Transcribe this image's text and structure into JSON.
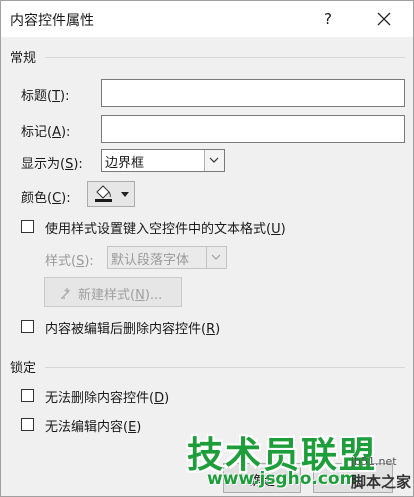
{
  "dialog": {
    "title": "内容控件属性",
    "help_label": "?"
  },
  "general": {
    "section_label": "常规",
    "title_field": {
      "label": "标题(",
      "key": "T",
      "close": "):",
      "value": ""
    },
    "tag_field": {
      "label": "标记(",
      "key": "A",
      "close": "):",
      "value": ""
    },
    "show_as": {
      "label": "显示为(",
      "key": "S",
      "close": "):",
      "value": "边界框"
    },
    "color": {
      "label": "颜色(",
      "key": "C",
      "close": "):",
      "icon": "paint-bucket-icon"
    },
    "use_style": {
      "label": "使用样式设置键入空控件中的文本格式(",
      "key": "U",
      "close": ")",
      "checked": false
    },
    "style": {
      "label": "样式(",
      "key": "S",
      "close": "):",
      "value": "默认段落字体",
      "enabled": false
    },
    "new_style": {
      "label": "新建样式(",
      "key": "N",
      "close": ")...",
      "enabled": false
    },
    "remove_after_edit": {
      "label": "内容被编辑后删除内容控件(",
      "key": "R",
      "close": ")",
      "checked": false
    }
  },
  "lock": {
    "section_label": "锁定",
    "cannot_delete": {
      "label": "无法删除内容控件(",
      "key": "D",
      "close": ")",
      "checked": false
    },
    "cannot_edit": {
      "label": "无法编辑内容(",
      "key": "E",
      "close": ")",
      "checked": false
    }
  },
  "footer": {
    "ok_label": "确定"
  },
  "watermark": {
    "logo_text": "技术员联盟",
    "url_text": "www.jsgho.com",
    "site_text": "jb51.net",
    "brand_text": "脚本之家",
    "color": "#1e9e3a"
  }
}
